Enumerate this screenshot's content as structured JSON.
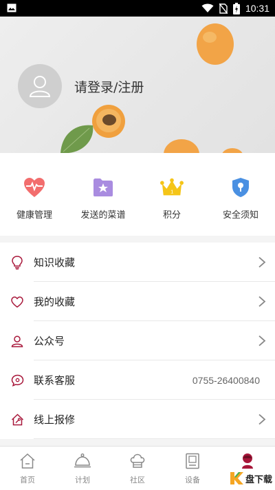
{
  "status_bar": {
    "time": "10:31",
    "icons": [
      "image-icon",
      "wifi-icon",
      "no-sim-icon",
      "battery-charging-icon"
    ]
  },
  "profile": {
    "login_label": "请登录/注册"
  },
  "shortcuts": [
    {
      "label": "健康管理",
      "icon": "heart-pulse-icon",
      "color": "#f26d6d"
    },
    {
      "label": "发送的菜谱",
      "icon": "folder-star-icon",
      "color": "#a98ce0"
    },
    {
      "label": "积分",
      "icon": "crown-icon",
      "color": "#f5c518"
    },
    {
      "label": "安全须知",
      "icon": "shield-icon",
      "color": "#4a90e2"
    }
  ],
  "menu": [
    {
      "label": "知识收藏",
      "icon": "lightbulb-icon",
      "value": ""
    },
    {
      "label": "我的收藏",
      "icon": "heart-outline-icon",
      "value": ""
    },
    {
      "label": "公众号",
      "icon": "person-icon",
      "value": ""
    },
    {
      "label": "联系客服",
      "icon": "chat-bubble-icon",
      "value": "0755-26400840"
    },
    {
      "label": "线上报修",
      "icon": "home-wrench-icon",
      "value": ""
    }
  ],
  "bottom_nav": [
    {
      "label": "首页",
      "icon": "home-icon"
    },
    {
      "label": "计划",
      "icon": "cloche-icon"
    },
    {
      "label": "社区",
      "icon": "chef-hat-icon"
    },
    {
      "label": "设备",
      "icon": "device-icon"
    },
    {
      "label": "",
      "icon": "profile-active-icon",
      "active": true
    }
  ],
  "watermark": {
    "text": "盘下载"
  },
  "colors": {
    "accent": "#a8173a",
    "menu_icon": "#a8173a",
    "chevron": "#888888"
  }
}
